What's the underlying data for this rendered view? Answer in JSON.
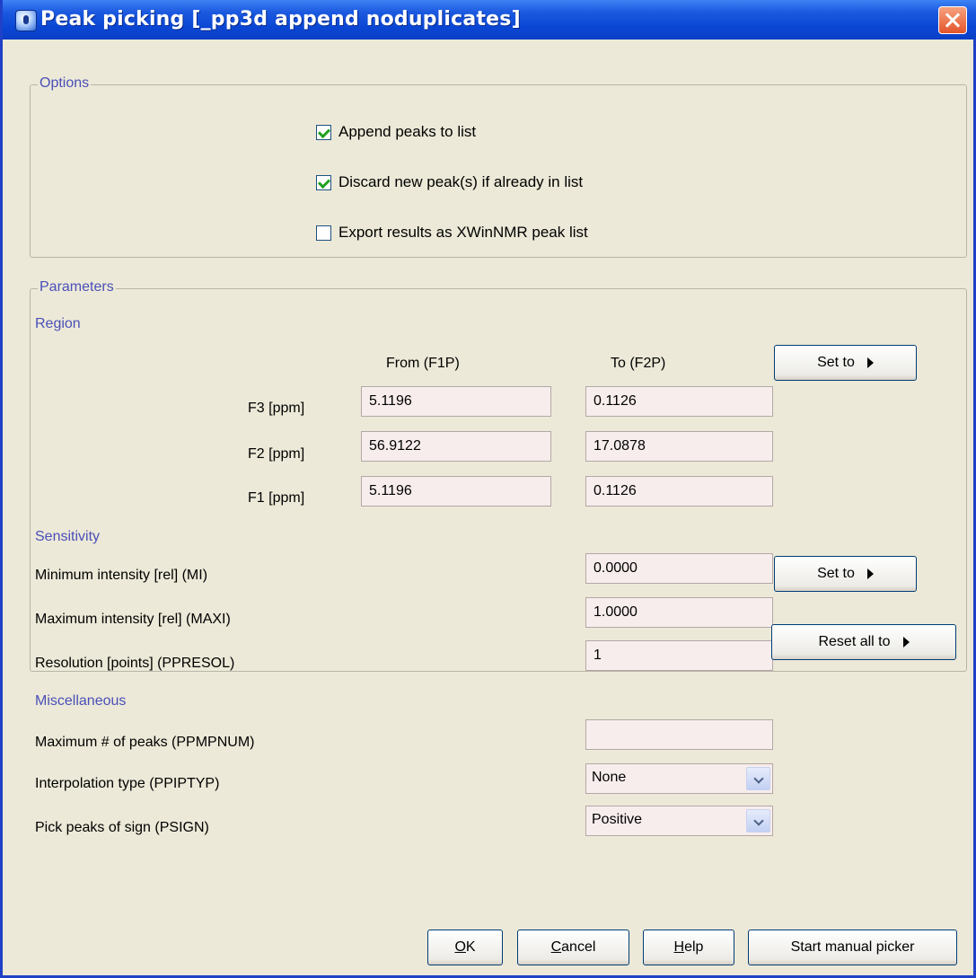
{
  "window": {
    "title": "Peak picking [_pp3d append noduplicates]"
  },
  "options": {
    "legend": "Options",
    "checkboxes": [
      {
        "label": "Append peaks to list",
        "checked": true
      },
      {
        "label": "Discard new peak(s) if already in list",
        "checked": true
      },
      {
        "label": "Export results as XWinNMR peak list",
        "checked": false
      }
    ]
  },
  "parameters": {
    "legend": "Parameters",
    "region": {
      "title": "Region",
      "from_header": "From (F1P)",
      "to_header": "To (F2P)",
      "set_to_label": "Set to",
      "rows": [
        {
          "label": "F3 [ppm]",
          "from": "5.1196",
          "to": "0.1126"
        },
        {
          "label": "F2 [ppm]",
          "from": "56.9122",
          "to": "17.0878"
        },
        {
          "label": "F1 [ppm]",
          "from": "5.1196",
          "to": "0.1126"
        }
      ]
    },
    "sensitivity": {
      "title": "Sensitivity",
      "set_to_label": "Set to",
      "min_intensity": {
        "label": "Minimum intensity [rel] (MI)",
        "value": "0.0000"
      },
      "max_intensity": {
        "label": "Maximum intensity [rel] (MAXI)",
        "value": "1.0000"
      },
      "resolution": {
        "label": "Resolution [points] (PPRESOL)",
        "value": "1"
      }
    },
    "misc": {
      "title": "Miscellaneous",
      "max_peaks": {
        "label": "Maximum # of peaks (PPMPNUM)",
        "value": ""
      },
      "interpolation": {
        "label": "Interpolation type (PPIPTYP)",
        "value": "None"
      },
      "sign": {
        "label": "Pick peaks of sign (PSIGN)",
        "value": "Positive"
      }
    },
    "reset_label": "Reset all to"
  },
  "buttons": {
    "ok_mnemonic": "O",
    "ok_rest": "K",
    "cancel_mnemonic": "C",
    "cancel_rest": "ancel",
    "help_mnemonic": "H",
    "help_rest": "elp",
    "manual": "Start manual picker"
  },
  "colors": {
    "title_bar": "#0a46d4",
    "section_text": "#4a4fb8",
    "field_bg": "#f8eded",
    "dialog_bg": "#ece9d8"
  }
}
